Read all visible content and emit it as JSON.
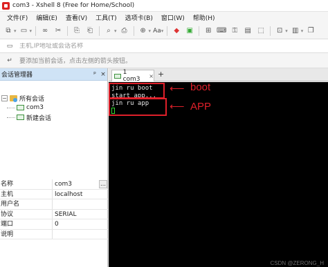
{
  "window": {
    "title": "com3 - Xshell 8 (Free for Home/School)"
  },
  "menu": [
    "文件(F)",
    "编辑(E)",
    "查看(V)",
    "工具(T)",
    "选项卡(B)",
    "窗口(W)",
    "帮助(H)"
  ],
  "toolbar": {
    "font_label": "Aa"
  },
  "addressbar": {
    "placeholder": "主机,IP地址或会话名称"
  },
  "hintbar": {
    "text": "要添加当前会话，点击左侧的箭头按钮。"
  },
  "session_panel": {
    "title": "会话管理器",
    "pin": "ᵖ",
    "close": "×",
    "tree": {
      "root": "所有会话",
      "items": [
        "com3",
        "新建会话"
      ]
    },
    "properties": [
      {
        "key": "名称",
        "value": "com3"
      },
      {
        "key": "主机",
        "value": "localhost"
      },
      {
        "key": "用户名",
        "value": ""
      },
      {
        "key": "协议",
        "value": "SERIAL"
      },
      {
        "key": "端口",
        "value": "0"
      },
      {
        "key": "说明",
        "value": ""
      }
    ]
  },
  "tabs": [
    {
      "label": "1 com3"
    }
  ],
  "terminal": {
    "lines": [
      "jin ru boot",
      "start app...",
      "jin ru app"
    ],
    "annotations": {
      "boot": "boot",
      "app": "APP"
    },
    "watermark": "CSDN @ZERONG_H"
  },
  "colors": {
    "annotation": "#e0202a",
    "terminal_bg": "#000000",
    "panel_header": "#cfe3f6"
  }
}
